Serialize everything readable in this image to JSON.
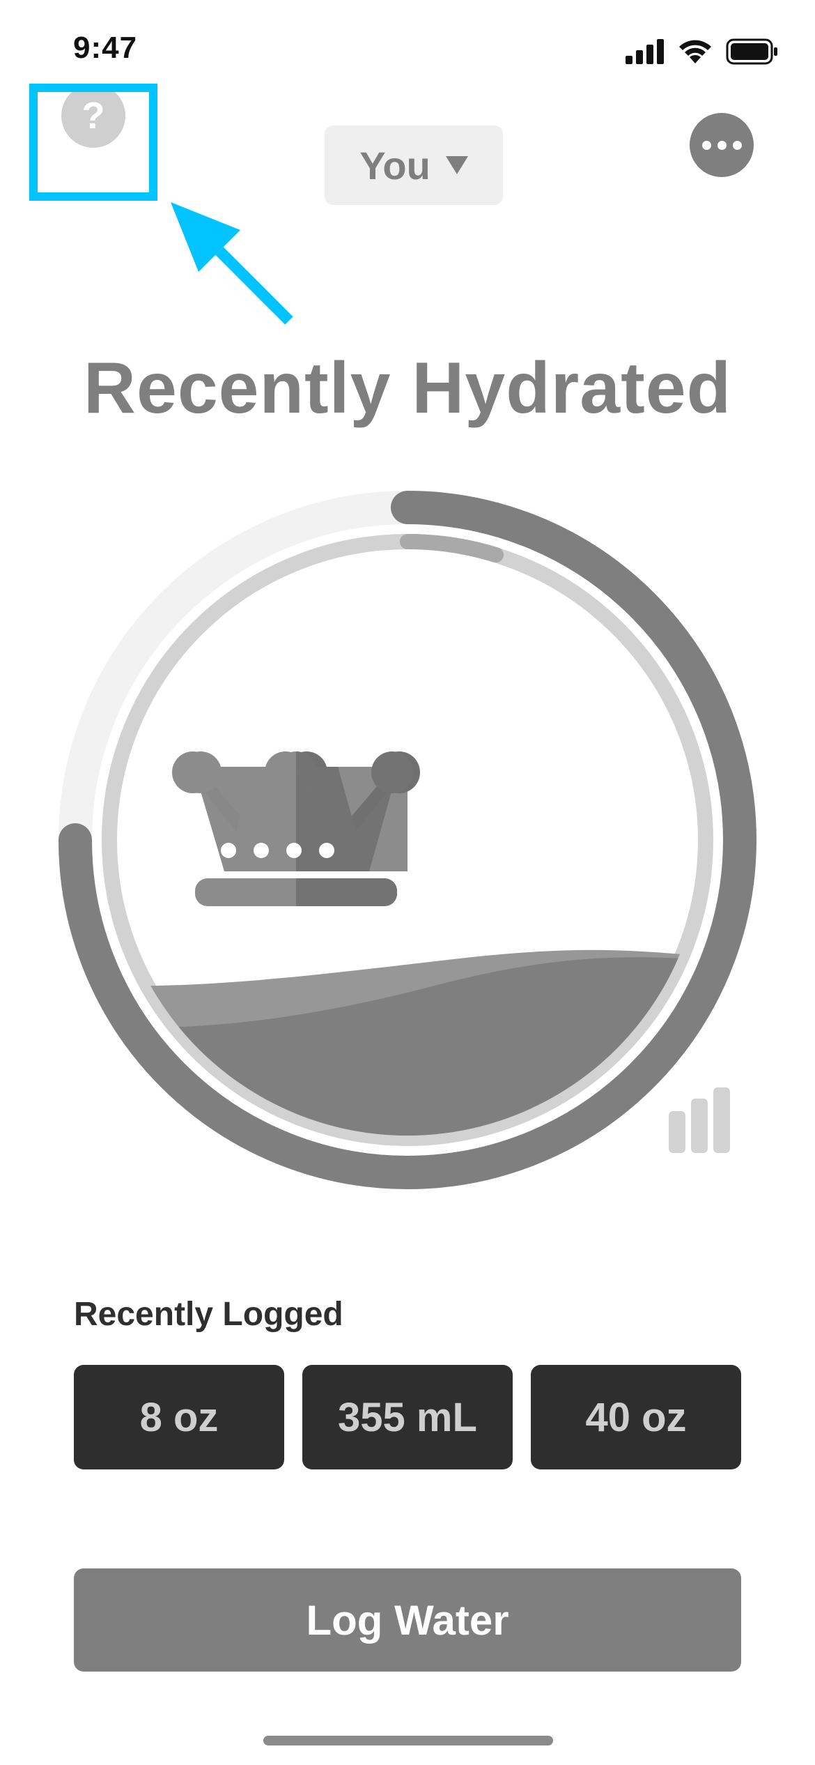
{
  "status_bar": {
    "time": "9:47"
  },
  "header": {
    "help_symbol": "?",
    "user_select_label": "You",
    "more_icon": "ellipsis-icon"
  },
  "main": {
    "title": "Recently Hydrated",
    "progress_ring": {
      "outer_progress_percent": 75,
      "inner_progress_percent": 5
    }
  },
  "recently_logged": {
    "label": "Recently Logged",
    "items": [
      {
        "label": "8 oz"
      },
      {
        "label": "355 mL"
      },
      {
        "label": "40 oz"
      }
    ]
  },
  "log_button": {
    "label": "Log Water"
  },
  "colors": {
    "accent_gray": "#7f7f7f",
    "highlight": "#00c3ff",
    "button_dark": "#2e2e2e"
  }
}
